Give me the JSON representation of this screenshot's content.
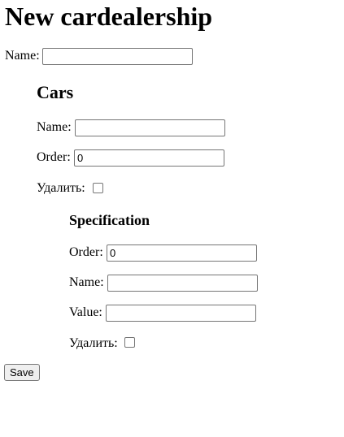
{
  "page": {
    "title": "New cardealership",
    "name_label": "Name:",
    "name_value": ""
  },
  "cars": {
    "heading": "Cars",
    "name_label": "Name:",
    "name_value": "",
    "order_label": "Order:",
    "order_value": "0",
    "delete_label": "Удалить:"
  },
  "specification": {
    "heading": "Specification",
    "order_label": "Order:",
    "order_value": "0",
    "name_label": "Name:",
    "name_value": "",
    "value_label": "Value:",
    "value_value": "",
    "delete_label": "Удалить:"
  },
  "actions": {
    "save_label": "Save"
  }
}
